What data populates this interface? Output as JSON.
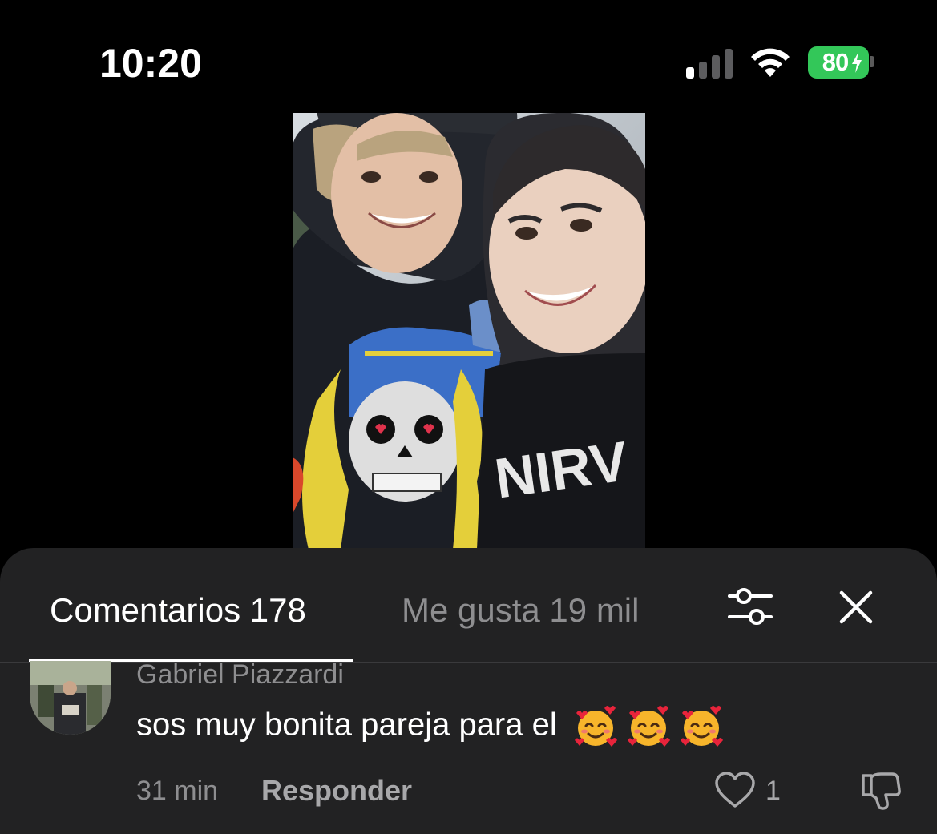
{
  "status_bar": {
    "time": "10:20",
    "battery_percent": "80",
    "battery_color": "#33c759",
    "icons": [
      "cellular-signal-icon",
      "wifi-icon",
      "battery-charging-icon"
    ]
  },
  "post": {
    "photo": "selfie-photo"
  },
  "comments_panel": {
    "tabs": [
      {
        "label": "Comentarios 178",
        "active": true
      },
      {
        "label": "Me gusta 19 mil",
        "active": false
      }
    ],
    "icons": [
      "filter-sliders-icon",
      "close-icon"
    ],
    "comment": {
      "author": "Gabriel Piazzardi",
      "text": "sos muy bonita pareja para el",
      "emojis": [
        "smiling-face-with-hearts",
        "smiling-face-with-hearts",
        "smiling-face-with-hearts"
      ],
      "time": "31 min",
      "reply_label": "Responder",
      "like_count": "1"
    }
  }
}
